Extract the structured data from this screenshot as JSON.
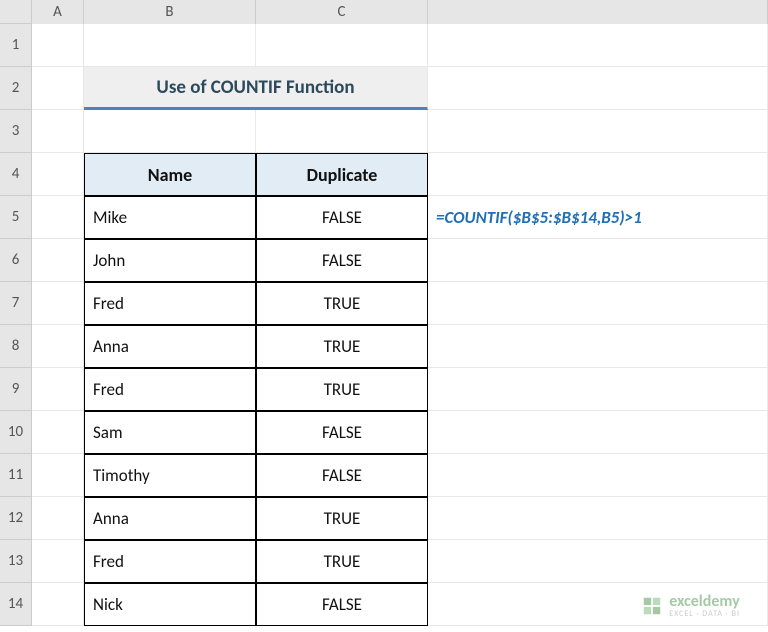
{
  "columns": [
    "A",
    "B",
    "C"
  ],
  "row_numbers": [
    "1",
    "2",
    "3",
    "4",
    "5",
    "6",
    "7",
    "8",
    "9",
    "10",
    "11",
    "12",
    "13",
    "14"
  ],
  "title": "Use of COUNTIF Function",
  "headers": {
    "name": "Name",
    "duplicate": "Duplicate"
  },
  "rows": [
    {
      "name": "Mike",
      "duplicate": "FALSE"
    },
    {
      "name": "John",
      "duplicate": "FALSE"
    },
    {
      "name": "Fred",
      "duplicate": "TRUE"
    },
    {
      "name": "Anna",
      "duplicate": "TRUE"
    },
    {
      "name": "Fred",
      "duplicate": "TRUE"
    },
    {
      "name": "Sam",
      "duplicate": "FALSE"
    },
    {
      "name": "Timothy",
      "duplicate": "FALSE"
    },
    {
      "name": "Anna",
      "duplicate": "TRUE"
    },
    {
      "name": "Fred",
      "duplicate": "TRUE"
    },
    {
      "name": "Nick",
      "duplicate": "FALSE"
    }
  ],
  "formula": "=COUNTIF($B$5:$B$14,B5)>1",
  "watermark": {
    "brand": "exceldemy",
    "sub": "EXCEL · DATA · BI"
  },
  "chart_data": {
    "type": "table",
    "title": "Use of COUNTIF Function",
    "columns": [
      "Name",
      "Duplicate"
    ],
    "rows": [
      [
        "Mike",
        "FALSE"
      ],
      [
        "John",
        "FALSE"
      ],
      [
        "Fred",
        "TRUE"
      ],
      [
        "Anna",
        "TRUE"
      ],
      [
        "Fred",
        "TRUE"
      ],
      [
        "Sam",
        "FALSE"
      ],
      [
        "Timothy",
        "FALSE"
      ],
      [
        "Anna",
        "TRUE"
      ],
      [
        "Fred",
        "TRUE"
      ],
      [
        "Nick",
        "FALSE"
      ]
    ],
    "formula_cell": "C5",
    "formula": "=COUNTIF($B$5:$B$14,B5)>1"
  }
}
